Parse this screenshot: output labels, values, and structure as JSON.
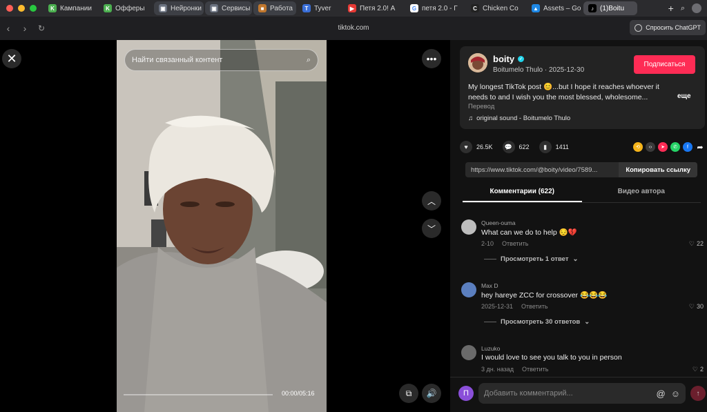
{
  "browser": {
    "tabs": [
      {
        "label": "Кампании",
        "icon": "k-icon",
        "color": "#4caf50",
        "glyph": "K"
      },
      {
        "label": "Офферы",
        "icon": "k-icon",
        "color": "#4caf50",
        "glyph": "K"
      },
      {
        "label": "Нейронки",
        "icon": "folder-icon",
        "color": "#6b7280",
        "glyph": "▣"
      },
      {
        "label": "Сервисы",
        "icon": "folder-icon",
        "color": "#6b7280",
        "glyph": "▣"
      },
      {
        "label": "Работа",
        "icon": "briefcase-icon",
        "color": "#c0772e",
        "glyph": "■"
      },
      {
        "label": "Tyver",
        "icon": "tyver-icon",
        "color": "#3a6fd8",
        "glyph": "T"
      },
      {
        "label": "Петя 2.0! A",
        "icon": "youtube-icon",
        "color": "#e53935",
        "glyph": "▶"
      },
      {
        "label": "петя 2.0 - Г",
        "icon": "google-icon",
        "color": "#ffffff",
        "glyph": "G"
      },
      {
        "label": "Chicken Co",
        "icon": "chicken-icon",
        "color": "#222222",
        "glyph": "C"
      },
      {
        "label": "Assets – Go",
        "icon": "drive-icon",
        "color": "#1e88e5",
        "glyph": "▲"
      },
      {
        "label": "(1)Boitu",
        "icon": "tiktok-icon",
        "color": "#000000",
        "glyph": "♪"
      }
    ],
    "url": "tiktok.com",
    "ask_chatgpt": "Спросить ChatGPT"
  },
  "video": {
    "search_placeholder": "Найти связанный контент",
    "time": "00:00/05:16",
    "progress": 0.0
  },
  "post": {
    "username": "boity",
    "display_name": "Boitumelo Thulo",
    "date": "2025-12-30",
    "follow_label": "Подписаться",
    "description": "My longest TikTok post 😊...but I hope it reaches whoever it needs to and I wish you the most blessed, wholesome...",
    "more_label": "еще",
    "translate_label": "Перевод",
    "sound": "original sound - Boitumelo Thulo",
    "likes": "26.5K",
    "comments": "622",
    "saves": "1411",
    "link": "https://www.tiktok.com/@boity/video/7589...",
    "copy_label": "Копировать ссылку"
  },
  "tabs": {
    "comments": "Комментарии (622)",
    "author_videos": "Видео автора"
  },
  "comments": [
    {
      "user": "Queen-ouma",
      "text": "What can we do to help 😔💔",
      "date": "2-10",
      "reply": "Ответить",
      "likes": "22",
      "replies": "Просмотреть 1 ответ"
    },
    {
      "user": "Max D",
      "text": "hey hareye ZCC for crossover 😂😂😂",
      "date": "2025-12-31",
      "reply": "Ответить",
      "likes": "30",
      "replies": "Просмотреть 30 ответов"
    },
    {
      "user": "Luzuko",
      "text": "I would love to see you talk to you in person",
      "date": "3 дн. назад",
      "reply": "Ответить",
      "likes": "2",
      "replies": ""
    }
  ],
  "composer": {
    "avatar_letter": "П",
    "placeholder": "Добавить комментарий..."
  }
}
